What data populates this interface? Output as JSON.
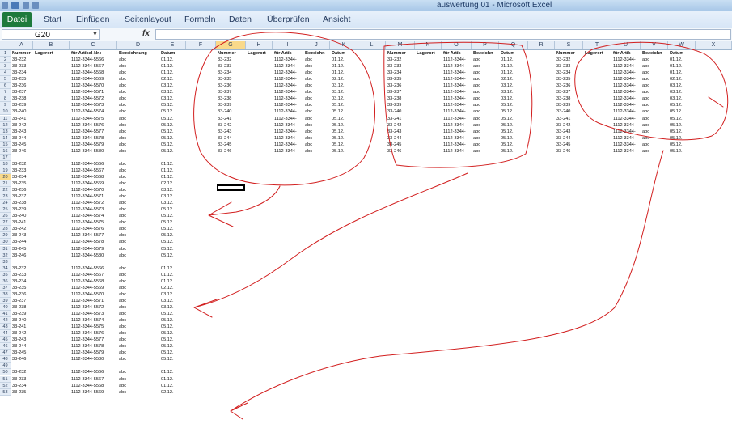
{
  "window": {
    "title": "auswertung 01  -  Microsoft Excel"
  },
  "ribbon": {
    "tabs": [
      "Datei",
      "Start",
      "Einfügen",
      "Seitenlayout",
      "Formeln",
      "Daten",
      "Überprüfen",
      "Ansicht"
    ]
  },
  "formula_bar": {
    "name_box": "G20",
    "fx_label": "fx",
    "content": ""
  },
  "columns": [
    "A",
    "B",
    "C",
    "D",
    "E",
    "F",
    "G",
    "H",
    "I",
    "J",
    "K",
    "L",
    "M",
    "N",
    "O",
    "P",
    "Q",
    "R",
    "S",
    "T",
    "U",
    "V",
    "W",
    "X"
  ],
  "selected": {
    "column": "G",
    "row": "20"
  },
  "rows": [
    "1",
    "2",
    "3",
    "4",
    "5",
    "6",
    "7",
    "8",
    "9",
    "10",
    "11",
    "12",
    "13",
    "14",
    "15",
    "16",
    "17",
    "18",
    "19",
    "20",
    "21",
    "22",
    "23",
    "24",
    "25",
    "26",
    "27",
    "28",
    "29",
    "30",
    "31",
    "32",
    "33",
    "34",
    "35",
    "36",
    "37",
    "38",
    "39",
    "40",
    "41",
    "42",
    "43",
    "44",
    "45",
    "46",
    "47",
    "48",
    "49",
    "50",
    "51",
    "52",
    "53"
  ],
  "block_a": {
    "headers": [
      "Nummer",
      "Lagerort",
      "für Artikel-Nr.:",
      "Bezeichnung",
      "Datum"
    ],
    "numbers": [
      "33-232",
      "33-233",
      "33-234",
      "33-235",
      "33-236",
      "33-237",
      "33-238",
      "33-239",
      "33-240",
      "33-241",
      "33-242",
      "33-243",
      "33-244",
      "33-245",
      "33-246"
    ],
    "articles": [
      "1112-3344-5566",
      "1112-3344-5567",
      "1112-3344-5568",
      "1112-3344-5569",
      "1112-3344-5570",
      "1112-3344-5571",
      "1112-3344-5572",
      "1112-3344-5573",
      "1112-3344-5574",
      "1112-3344-5575",
      "1112-3344-5576",
      "1112-3344-5577",
      "1112-3344-5578",
      "1112-3344-5579",
      "1112-3344-5580"
    ],
    "label": "abc",
    "dates": [
      "01.12.",
      "01.12.",
      "01.12.",
      "02.12.",
      "03.12.",
      "03.12.",
      "03.12.",
      "05.12.",
      "05.12.",
      "05.12.",
      "05.12.",
      "05.12.",
      "05.12.",
      "05.12.",
      "05.12."
    ]
  },
  "block_side": {
    "headers": [
      "Nummer",
      "Lagerort",
      "für Artik",
      "Bezeichn",
      "Datum"
    ],
    "article_short": "1112-3344-",
    "label": "abc"
  }
}
